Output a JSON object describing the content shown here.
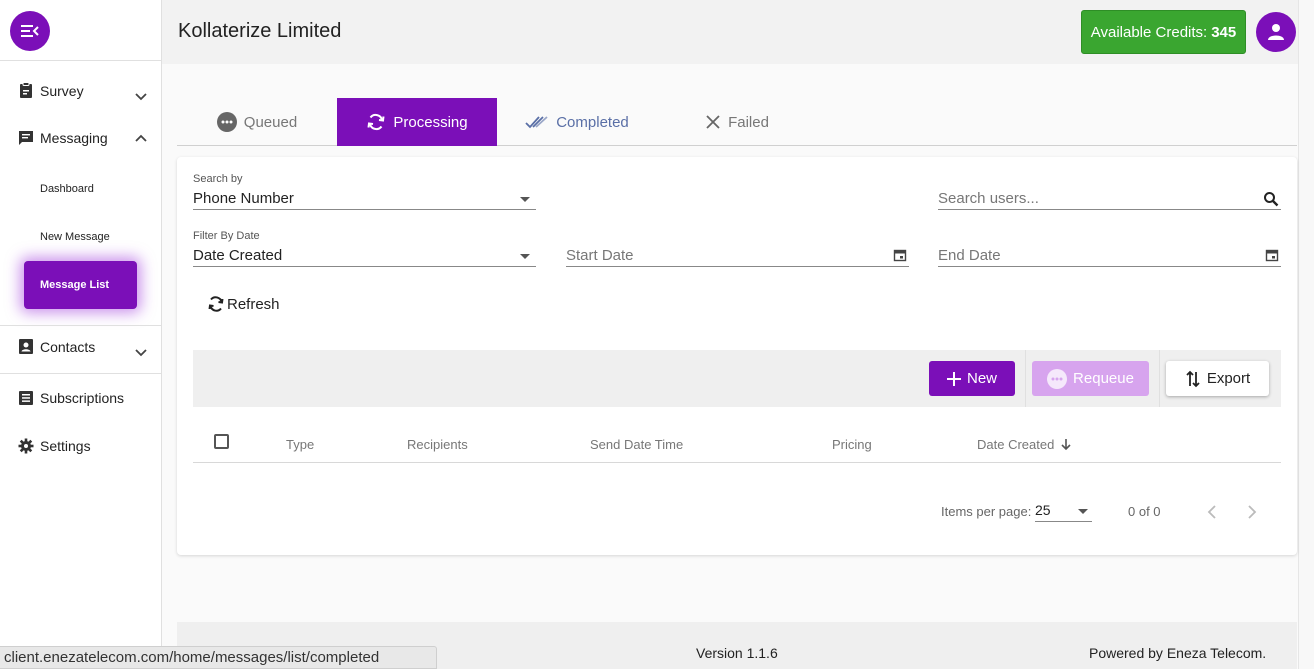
{
  "colors": {
    "primary": "#7b0fb8",
    "credits_green": "#3aa630",
    "requeue_disabled": "#d7a4ee",
    "completed_tab_text": "#5a6fa6"
  },
  "sidebar": {
    "items": [
      {
        "label": "Survey",
        "icon": "clipboard-icon",
        "expandable": true,
        "expanded": false
      },
      {
        "label": "Messaging",
        "icon": "message-icon",
        "expandable": true,
        "expanded": true
      },
      {
        "label": "Contacts",
        "icon": "contacts-icon",
        "expandable": true,
        "expanded": false
      },
      {
        "label": "Subscriptions",
        "icon": "list-icon",
        "expandable": false
      },
      {
        "label": "Settings",
        "icon": "gear-icon",
        "expandable": false
      }
    ],
    "messaging_sub": [
      "Dashboard",
      "New Message",
      "Message List"
    ],
    "active_sub": "Message List"
  },
  "header": {
    "org_name": "Kollaterize Limited",
    "credits_label": "Available Credits:",
    "credits_value": "345"
  },
  "tabs": [
    {
      "label": "Queued",
      "icon": "dots-circle-icon",
      "state": "normal"
    },
    {
      "label": "Processing",
      "icon": "sync-icon",
      "state": "active"
    },
    {
      "label": "Completed",
      "icon": "double-check-icon",
      "state": "completed"
    },
    {
      "label": "Failed",
      "icon": "close-icon",
      "state": "normal"
    }
  ],
  "filters": {
    "search_by_label": "Search by",
    "search_by_value": "Phone Number",
    "search_placeholder": "Search users...",
    "filter_date_label": "Filter By Date",
    "filter_date_value": "Date Created",
    "start_date_placeholder": "Start Date",
    "end_date_placeholder": "End Date"
  },
  "refresh_label": "Refresh",
  "toolbar": {
    "new_label": "New",
    "requeue_label": "Requeue",
    "export_label": "Export"
  },
  "table": {
    "columns": [
      "Type",
      "Recipients",
      "Send Date Time",
      "Pricing",
      "Date Created"
    ],
    "sorted_column": "Date Created",
    "sort_direction": "descending",
    "rows": []
  },
  "paginator": {
    "items_per_page_label": "Items per page:",
    "items_per_page_value": "25",
    "range_label": "0 of 0"
  },
  "footer": {
    "version": "Version 1.1.6",
    "powered_by": "Powered by Eneza Telecom."
  },
  "status_url": "client.enezatelecom.com/home/messages/list/completed"
}
